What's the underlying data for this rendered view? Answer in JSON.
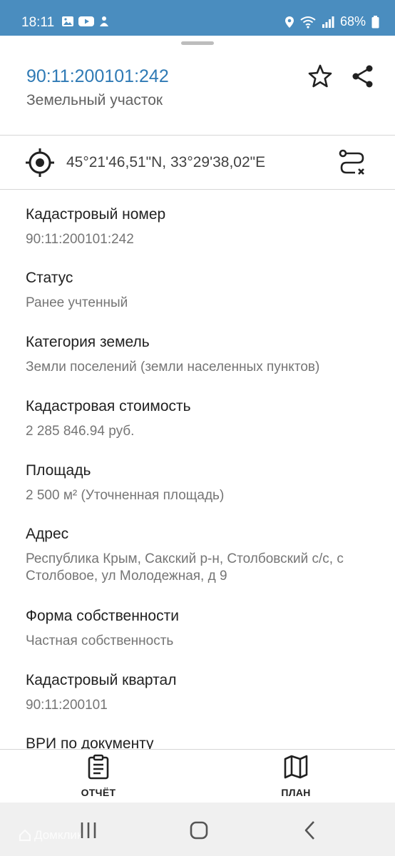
{
  "status_bar": {
    "time": "18:11",
    "battery": "68%"
  },
  "header": {
    "title": "90:11:200101:242",
    "subtitle": "Земельный участок"
  },
  "coords": {
    "text": "45°21'46,51\"N, 33°29'38,02\"E"
  },
  "fields": [
    {
      "label": "Кадастровый номер",
      "value": "90:11:200101:242"
    },
    {
      "label": "Статус",
      "value": "Ранее учтенный"
    },
    {
      "label": "Категория земель",
      "value": "Земли поселений (земли населенных пунктов)"
    },
    {
      "label": "Кадастровая стоимость",
      "value": "2 285 846.94 руб."
    },
    {
      "label": "Площадь",
      "value": "2 500 м² (Уточненная площадь)"
    },
    {
      "label": "Адрес",
      "value": "Республика Крым, Сакский р-н, Столбовский с/с, с Столбовое, ул Молодежная, д 9"
    },
    {
      "label": "Форма собственности",
      "value": "Частная собственность"
    },
    {
      "label": "Кадастровый квартал",
      "value": "90:11:200101"
    },
    {
      "label": "ВРИ по документу",
      "value": ""
    }
  ],
  "bottom_tabs": {
    "report": "ОТЧЁТ",
    "plan": "ПЛАН"
  },
  "watermark": "Домклик",
  "colors": {
    "status_bar": "#4a8dbf",
    "title": "#2f7ab5",
    "value_text": "#757575"
  }
}
